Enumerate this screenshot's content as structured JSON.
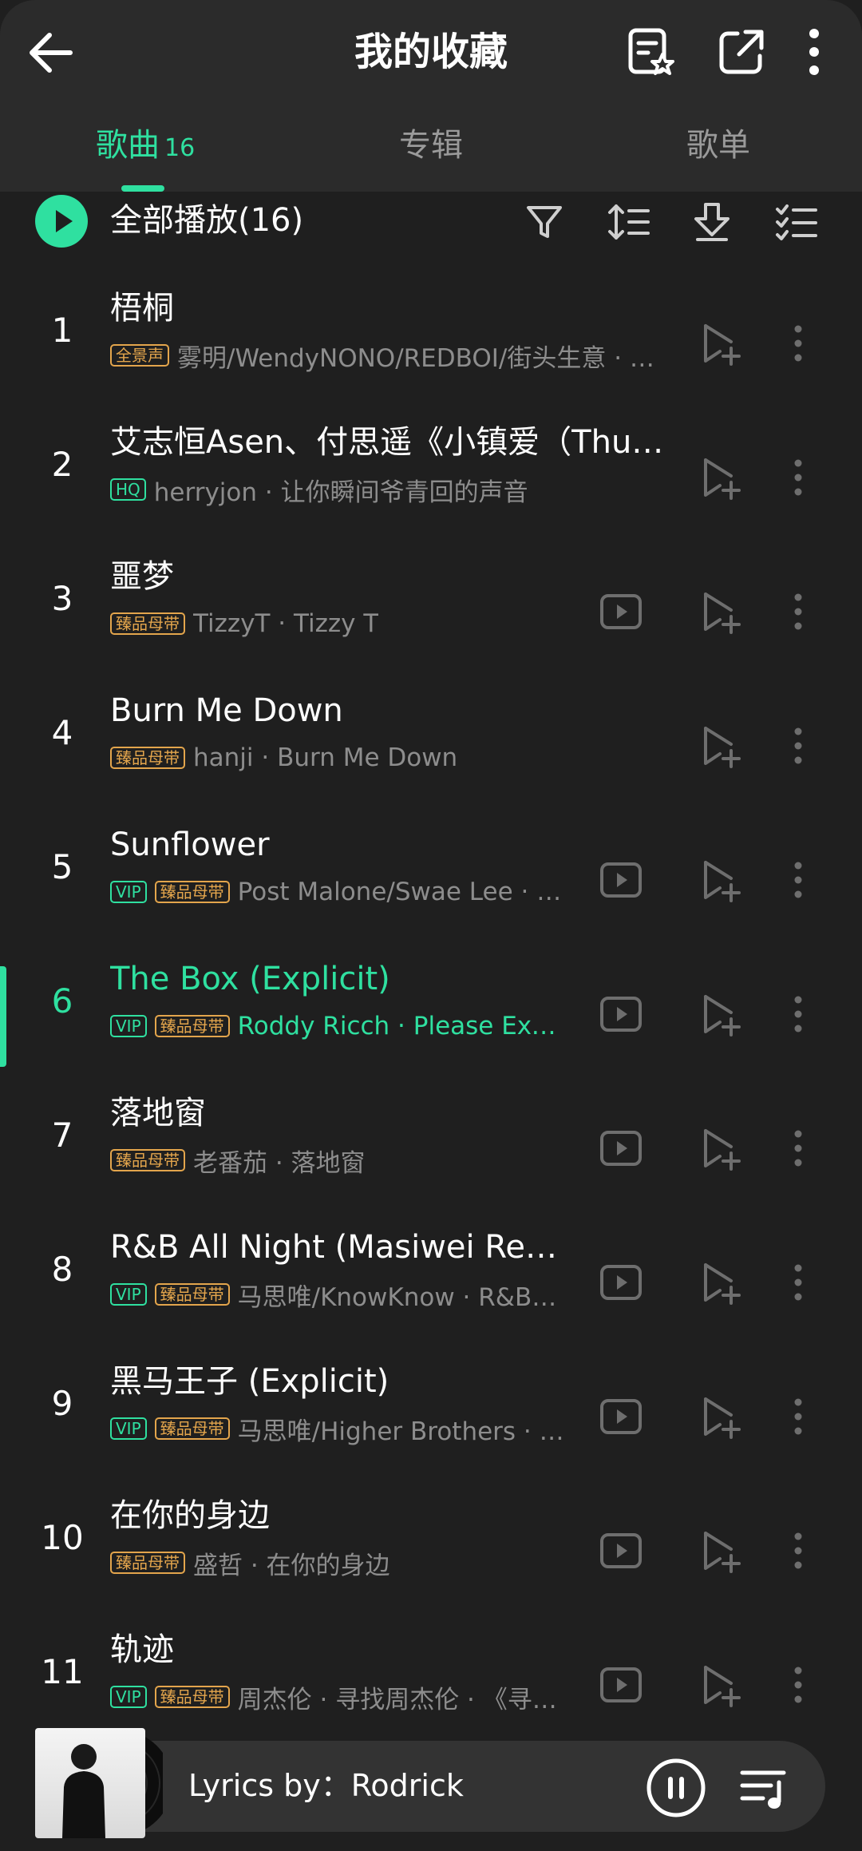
{
  "header": {
    "title": "我的收藏",
    "icons": [
      "back-arrow-icon",
      "starred-list-icon",
      "share-icon",
      "more-vertical-icon"
    ]
  },
  "tabs": [
    {
      "label": "歌曲",
      "count": "16",
      "active": true
    },
    {
      "label": "专辑",
      "active": false
    },
    {
      "label": "歌单",
      "active": false
    }
  ],
  "playall": {
    "label": "全部播放(16)",
    "icons": [
      "filter-icon",
      "sort-icon",
      "download-icon",
      "multi-select-icon"
    ]
  },
  "songs": [
    {
      "num": "1",
      "title": "梧桐",
      "badges": [
        {
          "text": "全景声",
          "style": "gold"
        }
      ],
      "artist": "雾明/WendyNONO/REDBOI/街头生意 · …",
      "has_mv": false
    },
    {
      "num": "2",
      "title": "艾志恒Asen、付思遥《小镇爱（Thu…",
      "badges": [
        {
          "text": "HQ",
          "style": "hq"
        }
      ],
      "artist": "herryjon · 让你瞬间爷青回的声音",
      "has_mv": false
    },
    {
      "num": "3",
      "title": "噩梦",
      "badges": [
        {
          "text": "臻品母带",
          "style": "gold"
        }
      ],
      "artist": "TizzyT · Tizzy T",
      "has_mv": true
    },
    {
      "num": "4",
      "title": "Burn Me Down",
      "badges": [
        {
          "text": "臻品母带",
          "style": "gold"
        }
      ],
      "artist": "hanji · Burn Me Down",
      "has_mv": false
    },
    {
      "num": "5",
      "title": "Sunflower",
      "badges": [
        {
          "text": "VIP",
          "style": "vip"
        },
        {
          "text": "臻品母带",
          "style": "gold"
        }
      ],
      "artist": "Post Malone/Swae Lee · …",
      "has_mv": true
    },
    {
      "num": "6",
      "title": "The Box (Explicit)",
      "badges": [
        {
          "text": "VIP",
          "style": "vip"
        },
        {
          "text": "臻品母带",
          "style": "gold"
        }
      ],
      "artist": "Roddy Ricch · Please Exc…",
      "has_mv": true,
      "playing": true
    },
    {
      "num": "7",
      "title": "落地窗",
      "badges": [
        {
          "text": "臻品母带",
          "style": "gold"
        }
      ],
      "artist": "老番茄 · 落地窗",
      "has_mv": true
    },
    {
      "num": "8",
      "title": "R&B All Night (Masiwei Remix)",
      "badges": [
        {
          "text": "VIP",
          "style": "vip"
        },
        {
          "text": "臻品母带",
          "style": "gold"
        }
      ],
      "artist": "马思唯/KnowKnow · R&B…",
      "has_mv": true
    },
    {
      "num": "9",
      "title": "黑马王子 (Explicit)",
      "badges": [
        {
          "text": "VIP",
          "style": "vip"
        },
        {
          "text": "臻品母带",
          "style": "gold"
        }
      ],
      "artist": "马思唯/Higher Brothers · …",
      "has_mv": true
    },
    {
      "num": "10",
      "title": "在你的身边",
      "badges": [
        {
          "text": "臻品母带",
          "style": "gold"
        }
      ],
      "artist": "盛哲 · 在你的身边",
      "has_mv": true
    },
    {
      "num": "11",
      "title": "轨迹",
      "badges": [
        {
          "text": "VIP",
          "style": "vip"
        },
        {
          "text": "臻品母带",
          "style": "gold"
        }
      ],
      "artist": "周杰伦 · 寻找周杰伦 · 《寻…",
      "has_mv": true
    }
  ],
  "mini_player": {
    "lyrics": "Lyrics by：Rodrick",
    "state": "playing",
    "icons": [
      "pause-icon",
      "playlist-queue-icon"
    ]
  },
  "colors": {
    "accent": "#2fe0a0",
    "gold_badge": "#e3a54c",
    "background": "#1f1f1f",
    "header_bg": "#2b2b2b",
    "secondary_text": "#8d8d8d"
  }
}
